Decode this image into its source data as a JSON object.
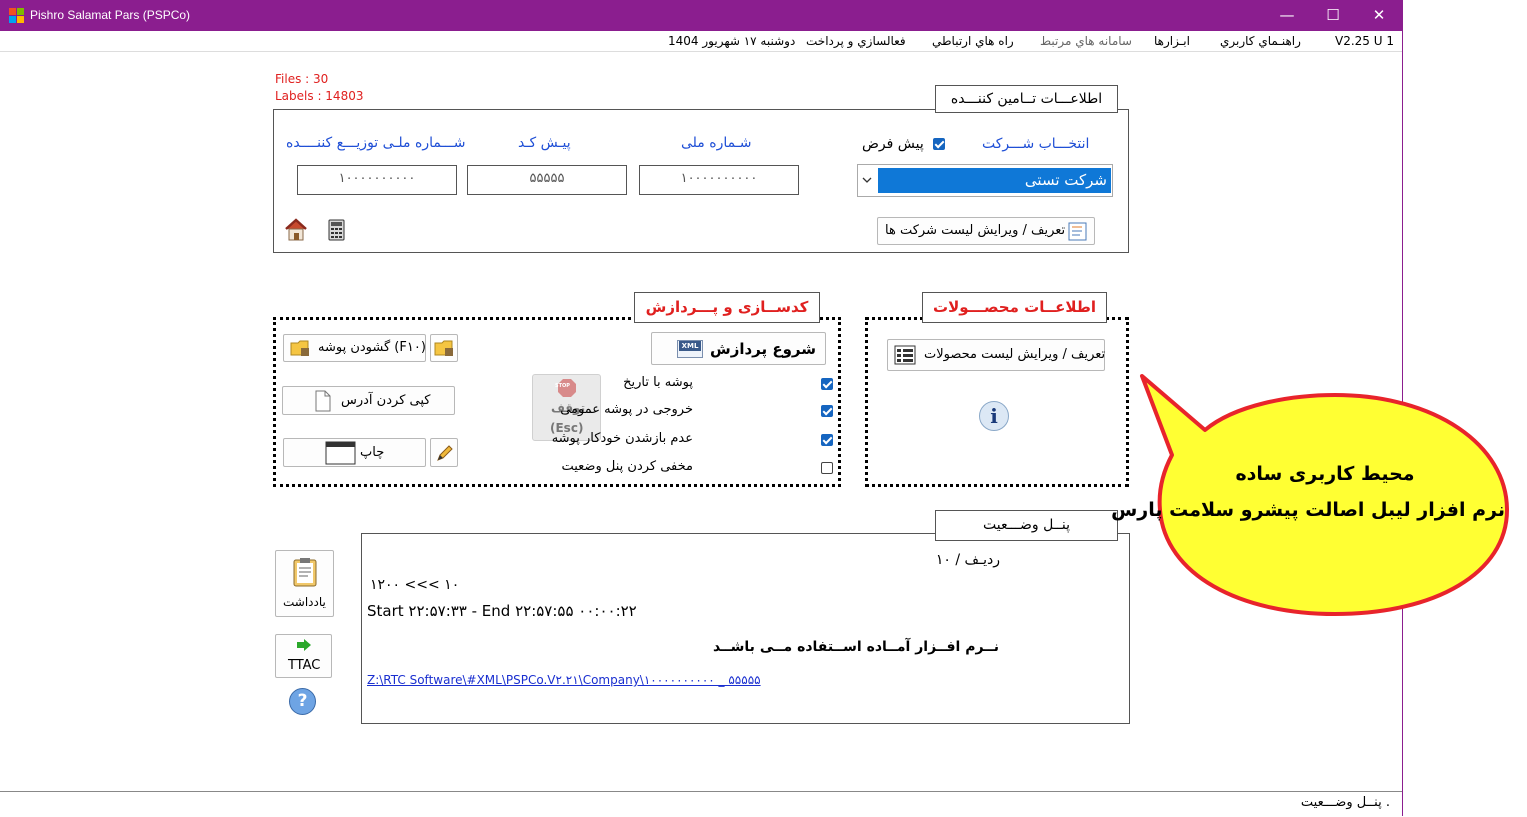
{
  "window": {
    "title": "Pishro Salamat Pars (PSPCo)",
    "minimize": "—",
    "maximize": "☐",
    "close": "✕"
  },
  "menu": {
    "version": "V2.25  U 1",
    "guide": "راهنـماي كاربري",
    "tools": "ابـزارها",
    "related": "سامانه هاي مرتبط",
    "contact": "راه هاي ارتباطي",
    "activation": "فعالسازي و پرداخت",
    "date": "دوشنبه ۱۷ شهریور 1404"
  },
  "stats": {
    "files": "Files : 30",
    "labels": "Labels : 14803"
  },
  "supplier": {
    "legend": "اطلاعـــات تــامین کننـــده",
    "select_company_label": "انتخـــاب شـــرکت",
    "default_label": "پیش فرض",
    "default_checked": true,
    "national_id_label": "شـماره ملی",
    "prefix_label": "پیـش کـد",
    "distributor_label": "شـــماره ملـی توزیـــع کننــــده",
    "national_id_value": "۱۰۰۰۰۰۰۰۰۰۰",
    "prefix_value": "۵۵۵۵۵",
    "distributor_value": "۱۰۰۰۰۰۰۰۰۰۰",
    "company_selected": "شرکت تستی",
    "define_companies_button": "تعریف / ویرایش لیست شرکت ها"
  },
  "coding": {
    "legend": "کدســازی و پـــردازش",
    "start_button": "شروع پردازش",
    "xml_badge": "XML",
    "stop_label": "توقف",
    "stop_key": "(Esc)",
    "stop_badge": "STOP",
    "open_folder_button": "گشودن پوشه (F۱۰)",
    "copy_address_button": "کپی کردن آدرس",
    "print_button": "چاپ",
    "options": [
      {
        "label": "پوشه با تاریخ",
        "checked": true
      },
      {
        "label": "خروجی در پوشه عمومی",
        "checked": true
      },
      {
        "label": "عدم بازشدن خودکار پوشه",
        "checked": true
      },
      {
        "label": "مخفی کردن پنل وضعیت",
        "checked": false
      }
    ]
  },
  "products": {
    "legend": "اطلاعــات محصـــولات",
    "define_products_button": "تعریف / ویرایش لیست محصولات",
    "info_glyph": "i"
  },
  "callout": {
    "line1": "محیط کاربری ساده",
    "line2": "نرم افزار لیبل اصالت پیشرو سلامت پارس"
  },
  "status_panel": {
    "legend": "پنــل وضـــعیت",
    "row_label": "ردیـف  /  ۱۰",
    "range": "۱۲۰۰  <<<  ۱۰",
    "timing": "Start ۲۲:۵۷:۳۳ - End ۲۲:۵۷:۵۵    ۰۰:۰۰:۲۲",
    "ready": "نــرم افــزار آمــاده اســتفاده مــی باشــد",
    "path": "Z:\\RTC Software\\#XML\\PSPCo.V۲.۲۱\\Company\\۱۰۰۰۰۰۰۰۰۰۰ _ ۵۵۵۵۵"
  },
  "side": {
    "note_button": "یادداشت",
    "ttac_button": "TTAC",
    "help_glyph": "?"
  },
  "statusbar": {
    "text": ". پنــل وضـــعیت"
  },
  "colors": {
    "titlebar": "#8b1e8f",
    "accent_blue": "#1f4fd6",
    "accent_red": "#e0201f",
    "callout_fill": "#ffff33",
    "callout_border": "#e8242b",
    "select_fill": "#0f78d7"
  }
}
